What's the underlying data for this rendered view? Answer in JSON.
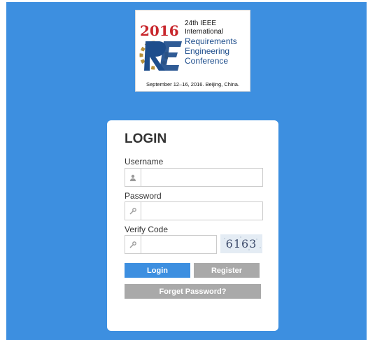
{
  "logo": {
    "year": "2016",
    "lines": [
      "24th IEEE",
      "International",
      "Requirements",
      "Engineering",
      "Conference"
    ],
    "date": "September 12–16, 2016. Beijing, China.",
    "colors": {
      "red": "#c8262c",
      "navy": "#1d4d8c",
      "gold": "#b7913b"
    }
  },
  "login": {
    "title": "LOGIN",
    "username": {
      "label": "Username",
      "value": "",
      "icon": "user-icon"
    },
    "password": {
      "label": "Password",
      "value": "",
      "icon": "key-icon"
    },
    "verify": {
      "label": "Verify Code",
      "value": "",
      "icon": "key-icon",
      "captcha": "6163"
    },
    "buttons": {
      "login": "Login",
      "register": "Register",
      "forget": "Forget Password?"
    }
  },
  "colors": {
    "background": "#3d8fe0",
    "primary": "#3d8fe0",
    "secondary": "#a9a9a9"
  }
}
